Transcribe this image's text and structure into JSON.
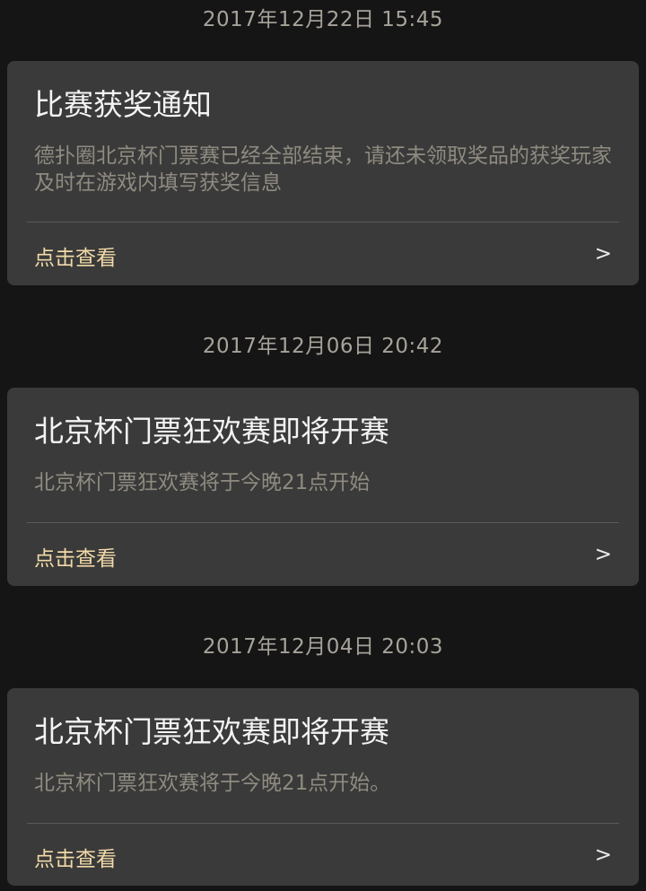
{
  "notifications": [
    {
      "timestamp": "2017年12月22日 15:45",
      "title": "比赛获奖通知",
      "body": "德扑圈北京杯门票赛已经全部结束，请还未领取奖品的获奖玩家及时在游戏内填写获奖信息",
      "link_label": "点击查看",
      "chevron": ">"
    },
    {
      "timestamp": "2017年12月06日 20:42",
      "title": "北京杯门票狂欢赛即将开赛",
      "body": "北京杯门票狂欢赛将于今晚21点开始",
      "link_label": "点击查看",
      "chevron": ">"
    },
    {
      "timestamp": "2017年12月04日 20:03",
      "title": "北京杯门票狂欢赛即将开赛",
      "body": "北京杯门票狂欢赛将于今晚21点开始。",
      "link_label": "点击查看",
      "chevron": ">"
    }
  ],
  "colors": {
    "background": "#151515",
    "card": "#3a3a3a",
    "title": "#f4f4f4",
    "body": "#8f8b80",
    "link": "#f1d9a8",
    "timestamp": "#a7a39a"
  }
}
